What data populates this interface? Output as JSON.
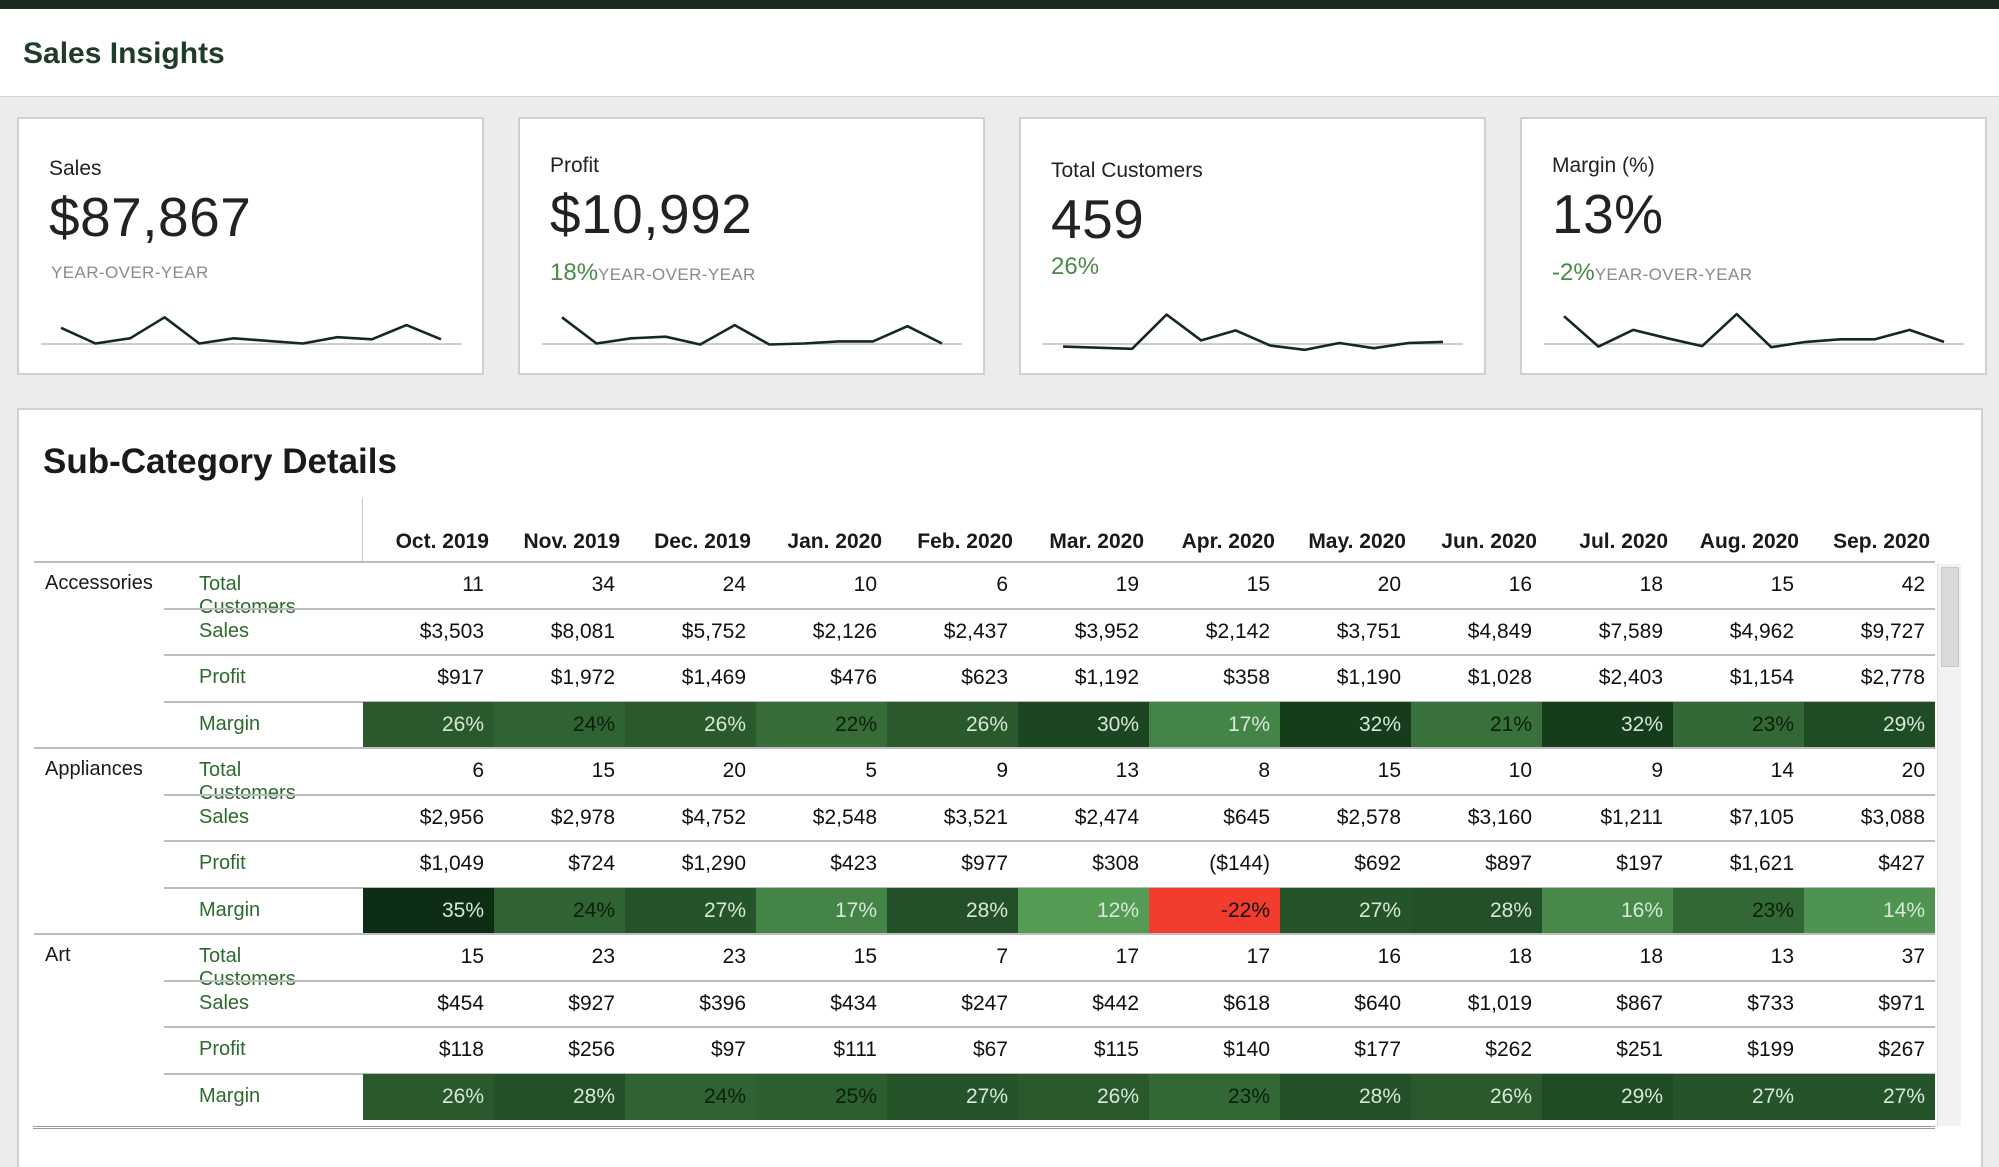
{
  "header": {
    "title": "Sales Insights"
  },
  "kpis": [
    {
      "label": "Sales",
      "value": "$87,867",
      "yoy_value": "",
      "yoy_caption": "YEAR-OVER-YEAR",
      "trend": [
        5,
        2,
        3,
        7,
        2,
        3,
        2.5,
        2,
        3.2,
        2.8,
        5.5,
        2.8
      ]
    },
    {
      "label": "Profit",
      "value": "$10,992",
      "yoy_value": "18%",
      "yoy_caption": "YEAR-OVER-YEAR",
      "trend": [
        7,
        2,
        3,
        3.3,
        1.8,
        5.5,
        1.8,
        2,
        2.4,
        2.4,
        5.3,
        2
      ]
    },
    {
      "label": "Total Customers",
      "value": "459",
      "yoy_value": "26%",
      "yoy_caption": "",
      "trend": [
        1.4,
        1.2,
        1,
        7.5,
        2.6,
        4.5,
        1.6,
        0.8,
        2.1,
        1.1,
        2.1,
        2.3
      ]
    },
    {
      "label": "Margin (%)",
      "value": "13%",
      "yoy_value": "-2%",
      "yoy_caption": "YEAR-OVER-YEAR",
      "trend": [
        7.2,
        1.4,
        4.6,
        3,
        1.5,
        7.6,
        1.3,
        2.3,
        2.8,
        2.8,
        4.6,
        2.3
      ]
    }
  ],
  "details": {
    "title": "Sub-Category Details",
    "months": [
      "Oct. 2019",
      "Nov. 2019",
      "Dec. 2019",
      "Jan. 2020",
      "Feb. 2020",
      "Mar. 2020",
      "Apr. 2020",
      "May. 2020",
      "Jun. 2020",
      "Jul. 2020",
      "Aug. 2020",
      "Sep. 2020"
    ],
    "categories": [
      {
        "name": "Accessories",
        "rows": [
          {
            "measure": "Total Customers",
            "values": [
              "11",
              "34",
              "24",
              "10",
              "6",
              "19",
              "15",
              "20",
              "16",
              "18",
              "15",
              "42"
            ]
          },
          {
            "measure": "Sales",
            "values": [
              "$3,503",
              "$8,081",
              "$5,752",
              "$2,126",
              "$2,437",
              "$3,952",
              "$2,142",
              "$3,751",
              "$4,849",
              "$7,589",
              "$4,962",
              "$9,727"
            ]
          },
          {
            "measure": "Profit",
            "values": [
              "$917",
              "$1,972",
              "$1,469",
              "$476",
              "$623",
              "$1,192",
              "$358",
              "$1,190",
              "$1,028",
              "$2,403",
              "$1,154",
              "$2,778"
            ]
          },
          {
            "measure": "Margin",
            "values": [
              "26%",
              "24%",
              "26%",
              "22%",
              "26%",
              "30%",
              "17%",
              "32%",
              "21%",
              "32%",
              "23%",
              "29%"
            ]
          }
        ]
      },
      {
        "name": "Appliances",
        "rows": [
          {
            "measure": "Total Customers",
            "values": [
              "6",
              "15",
              "20",
              "5",
              "9",
              "13",
              "8",
              "15",
              "10",
              "9",
              "14",
              "20"
            ]
          },
          {
            "measure": "Sales",
            "values": [
              "$2,956",
              "$2,978",
              "$4,752",
              "$2,548",
              "$3,521",
              "$2,474",
              "$645",
              "$2,578",
              "$3,160",
              "$1,211",
              "$7,105",
              "$3,088"
            ]
          },
          {
            "measure": "Profit",
            "values": [
              "$1,049",
              "$724",
              "$1,290",
              "$423",
              "$977",
              "$308",
              "($144)",
              "$692",
              "$897",
              "$197",
              "$1,621",
              "$427"
            ]
          },
          {
            "measure": "Margin",
            "values": [
              "35%",
              "24%",
              "27%",
              "17%",
              "28%",
              "12%",
              "-22%",
              "27%",
              "28%",
              "16%",
              "23%",
              "14%"
            ]
          }
        ]
      },
      {
        "name": "Art",
        "rows": [
          {
            "measure": "Total Customers",
            "values": [
              "15",
              "23",
              "23",
              "15",
              "7",
              "17",
              "17",
              "16",
              "18",
              "18",
              "13",
              "37"
            ]
          },
          {
            "measure": "Sales",
            "values": [
              "$454",
              "$927",
              "$396",
              "$434",
              "$247",
              "$442",
              "$618",
              "$640",
              "$1,019",
              "$867",
              "$733",
              "$971"
            ]
          },
          {
            "measure": "Profit",
            "values": [
              "$118",
              "$256",
              "$97",
              "$111",
              "$67",
              "$115",
              "$140",
              "$177",
              "$262",
              "$251",
              "$199",
              "$267"
            ]
          },
          {
            "measure": "Margin",
            "values": [
              "26%",
              "28%",
              "24%",
              "25%",
              "27%",
              "26%",
              "23%",
              "28%",
              "26%",
              "29%",
              "27%",
              "27%"
            ]
          }
        ]
      }
    ]
  },
  "colors": {
    "accent_green": "#2d6a2d",
    "negative_red": "#f23c2e",
    "margin_scale_light": "#4f9c4f",
    "margin_scale_dark": "#0f3a18"
  }
}
